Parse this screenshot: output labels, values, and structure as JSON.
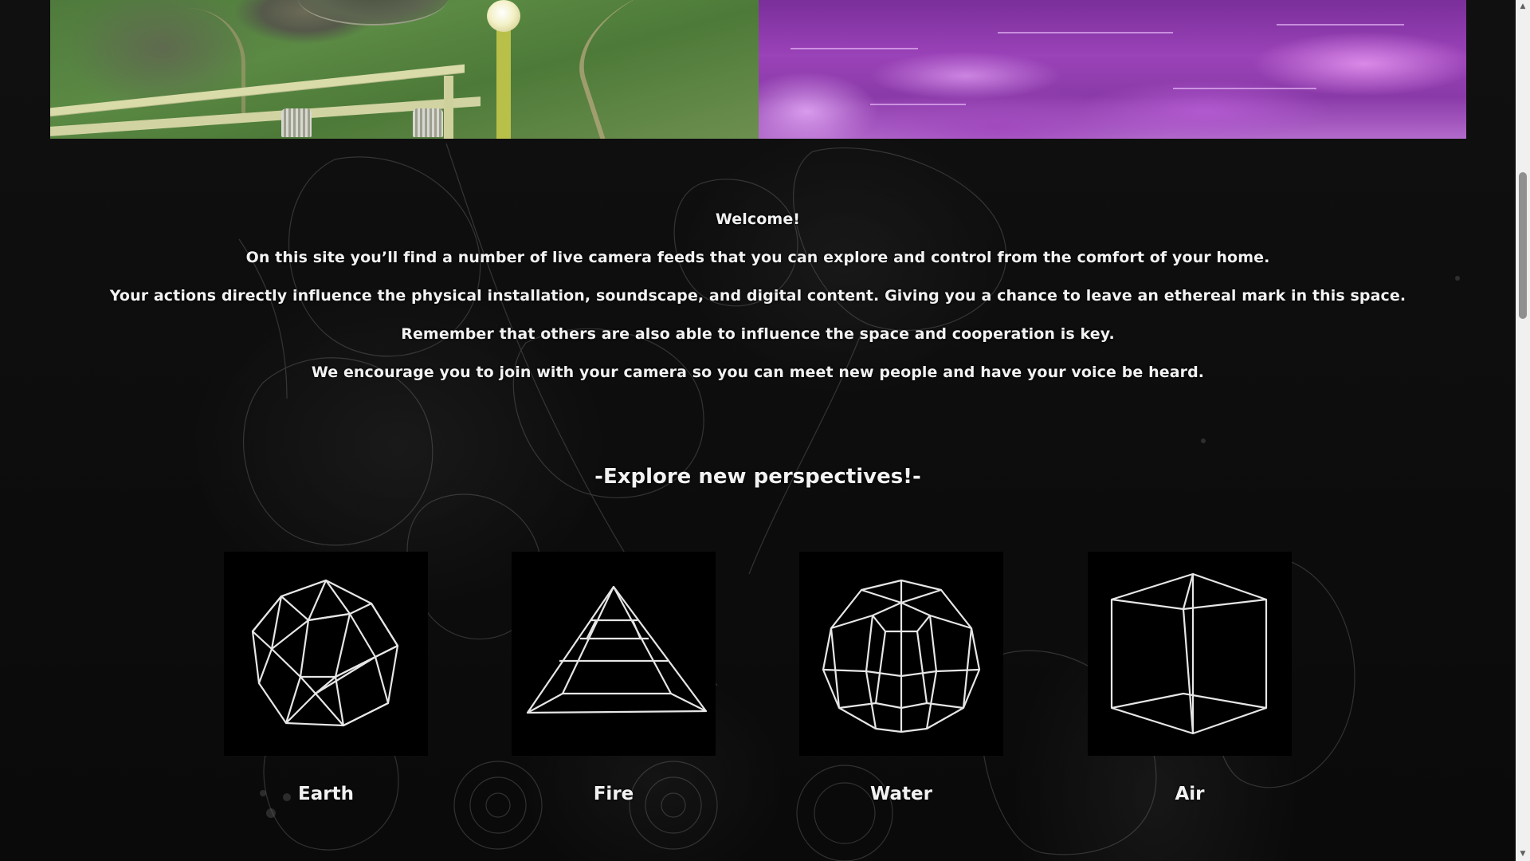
{
  "camera_feeds": [
    {
      "name": "garden-camera-feed"
    },
    {
      "name": "water-camera-feed"
    }
  ],
  "intro": {
    "welcome": "Welcome!",
    "line1": "On this site you’ll find a number of live camera feeds that you can explore and control from the comfort of your home.",
    "line2": "Your actions directly influence the physical installation, soundscape, and digital content. Giving you a chance to leave an ethereal mark in this space.",
    "line3": "Remember that others are also able to influence the space and cooperation is key.",
    "line4": "We encourage you to join with your camera so you can meet new people and have your voice be heard."
  },
  "explore": {
    "title": "-Explore new perspectives!-"
  },
  "elements": [
    {
      "label": "Earth",
      "icon": "icosahedron-icon"
    },
    {
      "label": "Fire",
      "icon": "tetrahedron-icon"
    },
    {
      "label": "Water",
      "icon": "polyhedron-icon"
    },
    {
      "label": "Air",
      "icon": "cube-icon"
    }
  ],
  "colors": {
    "background": "#0b0b0b",
    "text": "#f2f2f2",
    "tile": "#000000",
    "wireframe": "#e6e6e6"
  }
}
